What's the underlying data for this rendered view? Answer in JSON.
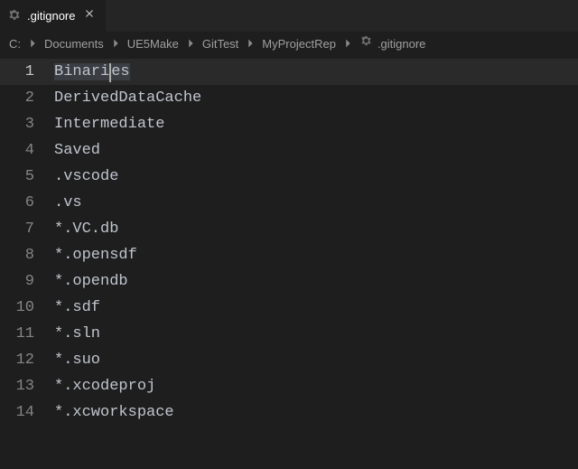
{
  "tab": {
    "filename": ".gitignore"
  },
  "breadcrumb": {
    "items": [
      "C:",
      "Documents",
      "UE5Make",
      "GitTest",
      "MyProjectRep"
    ],
    "filename": ".gitignore"
  },
  "editor": {
    "lines": [
      {
        "num": "1",
        "text": "Binaries"
      },
      {
        "num": "2",
        "text": "DerivedDataCache"
      },
      {
        "num": "3",
        "text": "Intermediate"
      },
      {
        "num": "4",
        "text": "Saved"
      },
      {
        "num": "5",
        "text": ".vscode"
      },
      {
        "num": "6",
        "text": ".vs"
      },
      {
        "num": "7",
        "text": "*.VC.db"
      },
      {
        "num": "8",
        "text": "*.opensdf"
      },
      {
        "num": "9",
        "text": "*.opendb"
      },
      {
        "num": "10",
        "text": "*.sdf"
      },
      {
        "num": "11",
        "text": "*.sln"
      },
      {
        "num": "12",
        "text": "*.suo"
      },
      {
        "num": "13",
        "text": "*.xcodeproj"
      },
      {
        "num": "14",
        "text": "*.xcworkspace"
      }
    ],
    "active_line_index": 0,
    "cursor": {
      "line_index": 0,
      "column": 6
    }
  }
}
